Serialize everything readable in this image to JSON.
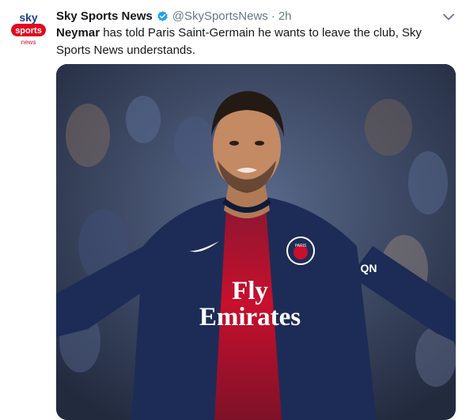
{
  "account": {
    "name": "Sky Sports News",
    "handle": "@SkySportsNews",
    "separator": "·",
    "time": "2h",
    "verified_icon": "verified-badge-icon",
    "verified_color": "#1da1f2",
    "avatar": {
      "logo_top": "sky",
      "logo_middle": "sports",
      "logo_bottom": "news",
      "brand_red": "#e10a1e"
    }
  },
  "tweet": {
    "subject": "Neymar",
    "body": " has told Paris Saint-Germain he wants to leave the club, Sky Sports News understands."
  },
  "media": {
    "shirt_sponsor_line1": "Fly",
    "shirt_sponsor_line2": "Emirates",
    "shirt_badge": "PARIS",
    "sleeve_text": "QN",
    "shirt_color": "#1d2c56",
    "stripe_color": "#c8102e"
  },
  "icons": {
    "menu": "chevron-down-icon"
  }
}
